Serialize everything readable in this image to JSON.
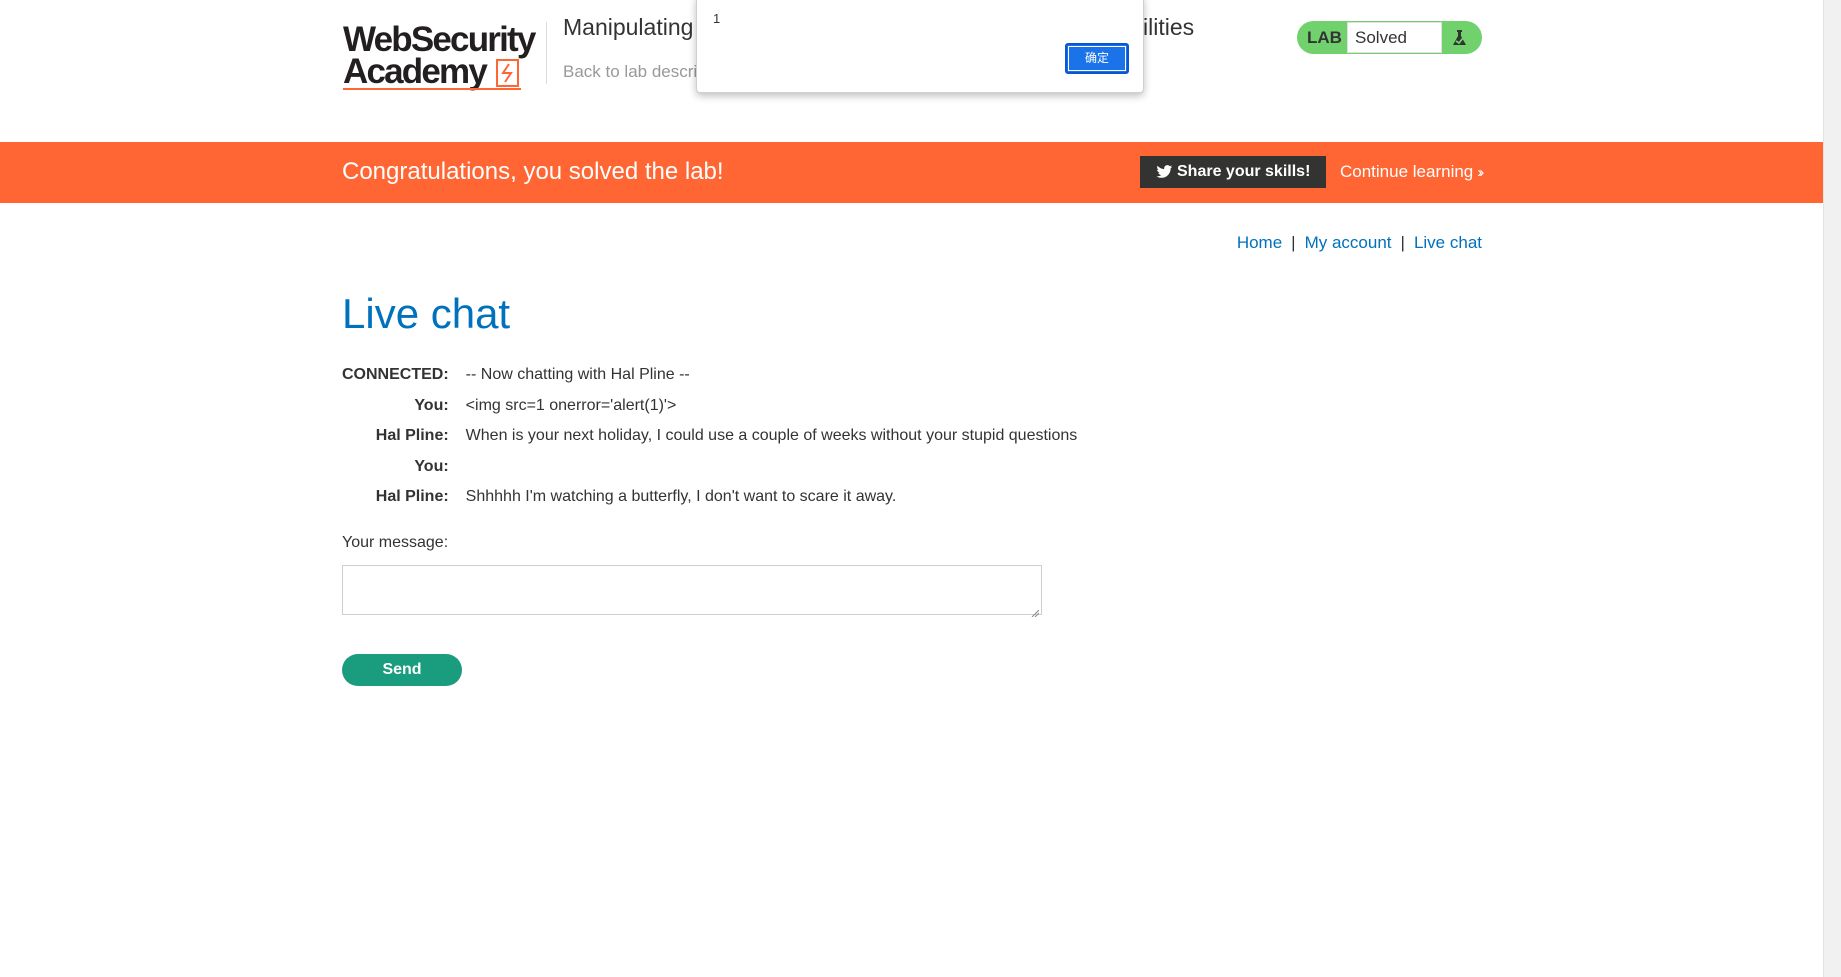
{
  "header": {
    "logo_line1": "WebSecurity",
    "logo_line2": "Academy",
    "lab_title_start": "Manipulating",
    "lab_title_end": "ilities",
    "back_link": "Back to lab descrip"
  },
  "lab_status": {
    "badge": "LAB",
    "status": "Solved",
    "icon": "flask-icon",
    "color": "#70d16d"
  },
  "alert": {
    "message": "1",
    "ok_label": "确定",
    "button_color": "#1a73e8"
  },
  "banner": {
    "text": "Congratulations, you solved the lab!",
    "share_label": "Share your skills!",
    "continue_label": "Continue learning",
    "color": "#ff6633"
  },
  "nav": {
    "items": [
      {
        "label": "Home"
      },
      {
        "label": "My account"
      },
      {
        "label": "Live chat"
      }
    ],
    "separator": "|"
  },
  "page": {
    "title": "Live chat",
    "title_color": "#0071bc"
  },
  "chat": {
    "messages": [
      {
        "who": "CONNECTED:",
        "text": "-- Now chatting with Hal Pline --"
      },
      {
        "who": "You:",
        "text": "<img src=1 onerror='alert(1)'>"
      },
      {
        "who": "Hal Pline:",
        "text": "When is your next holiday, I could use a couple of weeks without your stupid questions"
      },
      {
        "who": "You:",
        "text": ""
      },
      {
        "who": "Hal Pline:",
        "text": "Shhhhh I'm watching a butterfly, I don't want to scare it away."
      }
    ]
  },
  "form": {
    "label": "Your message:",
    "value": "",
    "send_label": "Send",
    "send_color": "#1a9c7f"
  }
}
